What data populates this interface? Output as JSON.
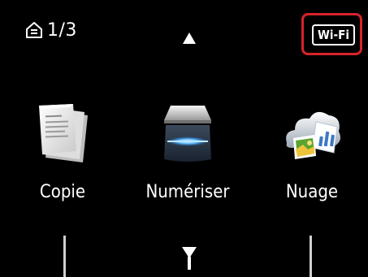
{
  "status_bar": {
    "page_indicator": "1/3",
    "wifi_label": "Wi-Fi",
    "highlight_color": "#d8232a"
  },
  "navigation": {
    "up_icon": "triangle-up-icon",
    "down_icon": "triangle-down-icon"
  },
  "menu": {
    "items": [
      {
        "label": "Copie",
        "icon": "copy-documents-icon"
      },
      {
        "label": "Numériser",
        "icon": "scanner-icon"
      },
      {
        "label": "Nuage",
        "icon": "cloud-icon"
      }
    ]
  }
}
